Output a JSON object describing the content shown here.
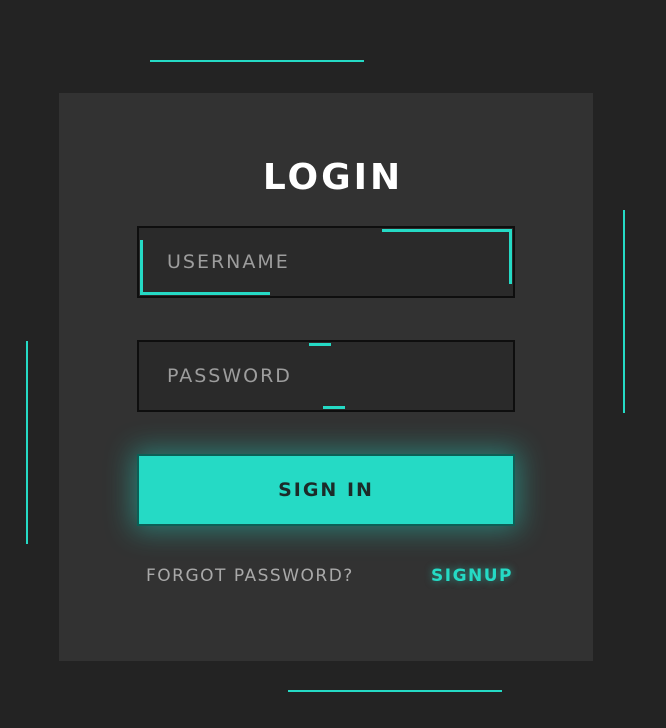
{
  "login": {
    "title": "LOGIN",
    "username_placeholder": "USERNAME",
    "username_value": "",
    "password_placeholder": "PASSWORD",
    "password_value": "",
    "signin_label": "SIGN IN",
    "forgot_label": "FORGOT PASSWORD?",
    "signup_label": "SIGNUP"
  },
  "colors": {
    "background": "#232323",
    "card": "#323232",
    "accent": "#25dac5",
    "field_border": "#0e0e0e"
  }
}
